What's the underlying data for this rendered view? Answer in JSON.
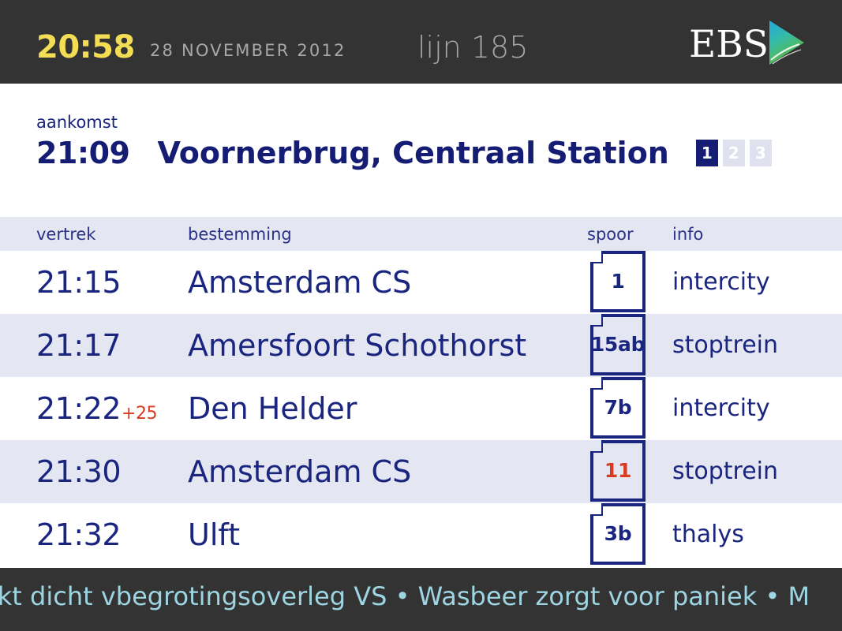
{
  "header": {
    "clock": "20:58",
    "date": "28 NOVEMBER 2012",
    "line": "lijn 185",
    "logo_text": "EBS",
    "logo_mark": "arrow-triangle-gradient",
    "clock_color": "#f2dd55",
    "bar_color": "#333333"
  },
  "arrival": {
    "label": "aankomst",
    "time": "21:09",
    "destination": "Voornerbrug, Centraal Station",
    "pages": [
      {
        "label": "1",
        "active": true
      },
      {
        "label": "2",
        "active": false
      },
      {
        "label": "3",
        "active": false
      }
    ]
  },
  "board": {
    "columns": {
      "departure": "vertrek",
      "destination": "bestemming",
      "platform": "spoor",
      "info": "info"
    },
    "rows": [
      {
        "time": "21:15",
        "delay": "",
        "destination": "Amsterdam CS",
        "platform": "1",
        "platform_changed": false,
        "info": "intercity"
      },
      {
        "time": "21:17",
        "delay": "",
        "destination": "Amersfoort Schothorst",
        "platform": "15ab",
        "platform_changed": false,
        "info": "stoptrein"
      },
      {
        "time": "21:22",
        "delay": "+25",
        "destination": "Den Helder",
        "platform": "7b",
        "platform_changed": false,
        "info": "intercity"
      },
      {
        "time": "21:30",
        "delay": "",
        "destination": "Amsterdam CS",
        "platform": "11",
        "platform_changed": true,
        "info": "stoptrein"
      },
      {
        "time": "21:32",
        "delay": "",
        "destination": "Ulft",
        "platform": "3b",
        "platform_changed": false,
        "info": "thalys"
      }
    ]
  },
  "ticker": {
    "text": "arkt dicht vbegrotingsoverleg VS  •  Wasbeer zorgt voor paniek  •  M",
    "color": "#9ed5e2"
  },
  "colors": {
    "primary_blue": "#1a2580",
    "deep_navy": "#141d73",
    "delay_red": "#d93b22",
    "row_alt": "#e4e6f1",
    "dark_bar": "#333333"
  }
}
